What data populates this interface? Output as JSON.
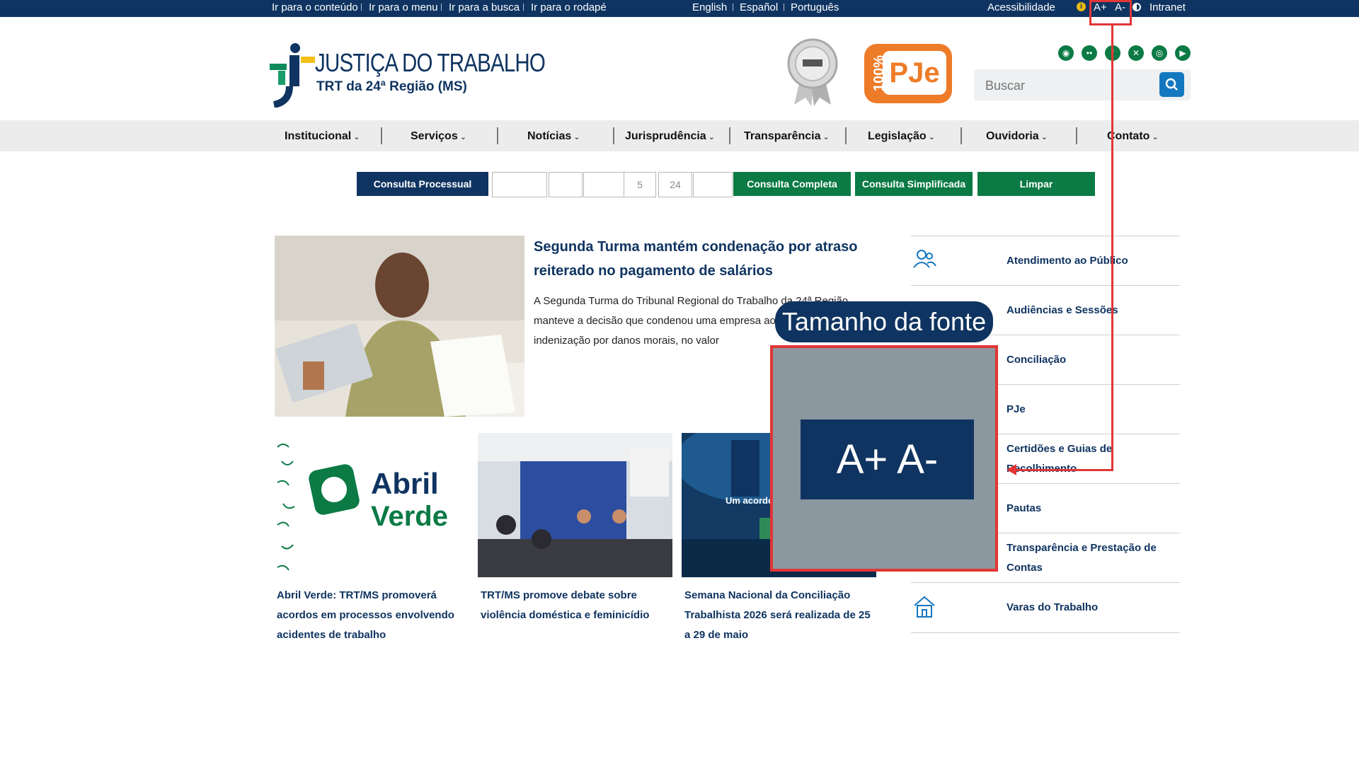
{
  "topbar": {
    "skip_links": [
      "Ir para o conteúdo",
      "Ir para o menu",
      "Ir para a busca",
      "Ir para o rodapé"
    ],
    "languages": [
      "English",
      "Español",
      "Português"
    ],
    "accessibility": "Acessibilidade",
    "font_increase": "A+",
    "font_decrease": "A-",
    "intranet": "Intranet"
  },
  "header": {
    "logo_title": "JUSTIÇA DO TRABALHO",
    "logo_subtitle": "TRT da 24ª Região (MS)",
    "pje_label": "PJe",
    "pje_badge": "100%",
    "social_icons": [
      "rss-icon",
      "flickr-icon",
      "facebook-icon",
      "x-icon",
      "instagram-icon",
      "youtube-icon"
    ],
    "search_placeholder": "Buscar"
  },
  "nav": {
    "items": [
      "Institucional",
      "Serviços",
      "Notícias",
      "Jurisprudência",
      "Transparência",
      "Legislação",
      "Ouvidoria",
      "Contato"
    ]
  },
  "consulta": {
    "label": "Consulta Processual",
    "field_values": [
      "",
      "",
      "",
      "5",
      "24",
      ""
    ],
    "btn_completa": "Consulta Completa",
    "btn_simplificada": "Consulta Simplificada",
    "btn_limpar": "Limpar"
  },
  "main_article": {
    "title": "Segunda Turma mantém condenação por atraso reiterado no pagamento de salários",
    "excerpt": "A Segunda Turma do Tribunal Regional do Trabalho da 24ª Região manteve a decisão que condenou uma empresa ao pagamento de indenização por danos morais, no valor"
  },
  "cards": [
    {
      "title": "Abril Verde: TRT/MS promoverá acordos em processos envolvendo acidentes de trabalho",
      "img_text_1": "Abril",
      "img_text_2": "Verde"
    },
    {
      "title": "TRT/MS promove debate sobre violência doméstica e feminicídio"
    },
    {
      "title": "Semana Nacional da Conciliação Trabalhista 2026 será realizada de 25 a 29 de maio",
      "img_text": "Um acordo"
    }
  ],
  "quick_links": [
    "Atendimento ao Público",
    "Audiências e Sessões",
    "Conciliação",
    "PJe",
    "Certidões e Guias de Recolhimento",
    "Pautas",
    "Transparência e Prestação de Contas",
    "Varas do Trabalho"
  ],
  "overlay": {
    "tooltip": "Tamanho da fonte",
    "zoom_text": "A+  A-",
    "highlight_color": "#e23636"
  },
  "colors": {
    "primary": "#0f3461",
    "green": "#0b7a45",
    "orange": "#ee7b27"
  }
}
